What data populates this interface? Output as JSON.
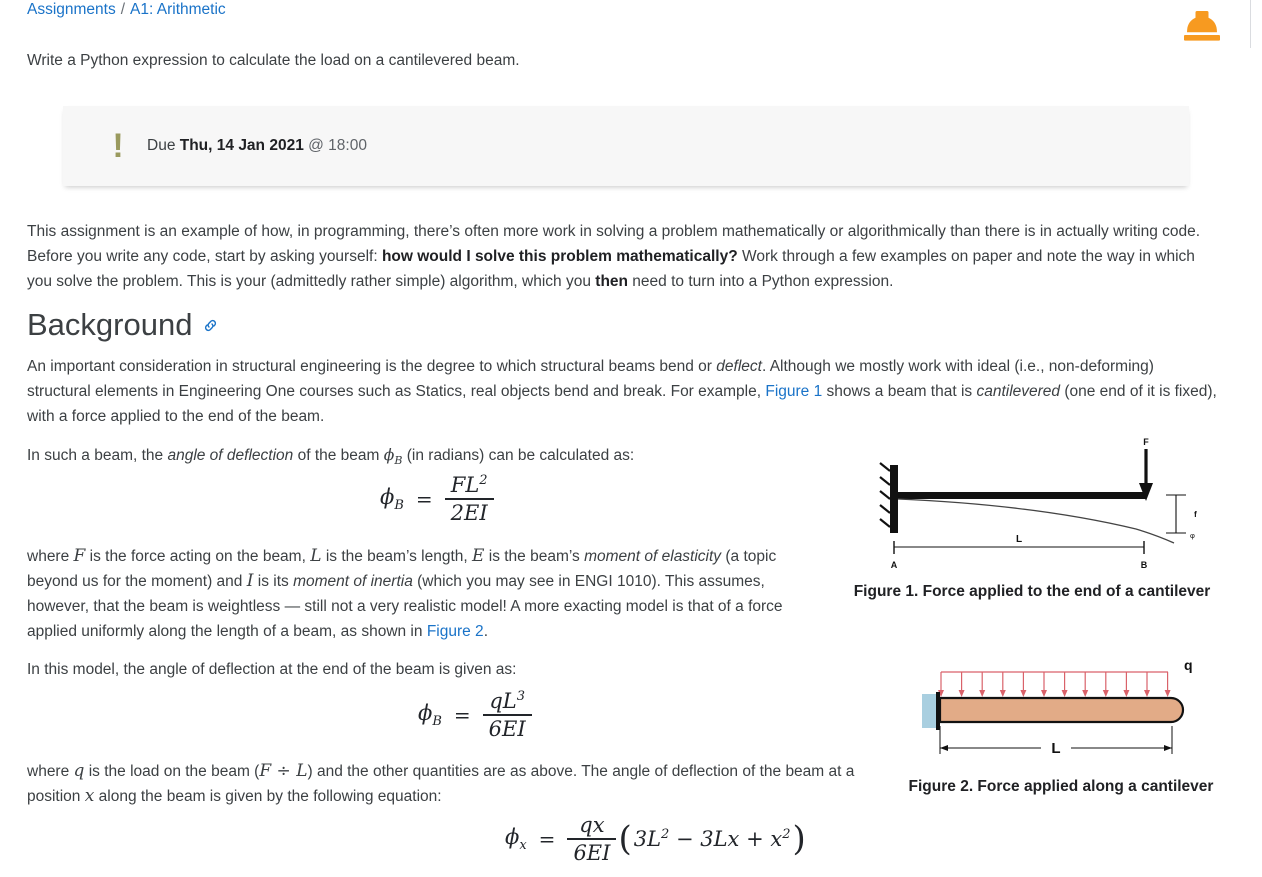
{
  "breadcrumb": {
    "items": [
      {
        "label": "Assignments"
      },
      {
        "label": "A1: Arithmetic"
      }
    ],
    "separator": "/"
  },
  "logo": {
    "icon": "hard-hat-icon",
    "color": "#f79a20"
  },
  "intro": {
    "text": "Write a Python expression to calculate the load on a cantilevered beam."
  },
  "callout": {
    "icon": "exclamation-icon",
    "icon_color": "#9a9a5e",
    "due_prefix": "Due ",
    "due_date": "Thu, 14 Jan 2021",
    "due_time": " @ 18:00",
    "background": "#f7f7f7"
  },
  "paragraphs": {
    "intro2": {
      "part1": "This assignment is an example of how, in programming, there’s often more work in solving a problem mathematically or algorithmically than there is in actually writing code. Before you write any code, start by asking yourself: ",
      "bold1": "how would I solve this problem mathematically?",
      "part2": " Work through a few examples on paper and note the way in which you solve the problem. This is your (admittedly rather simple) algorithm, which you ",
      "bold2": "then",
      "part3": " need to turn into a Python expression."
    },
    "background1": {
      "part1": "An important consideration in structural engineering is the degree to which structural beams bend or ",
      "italic1": "deflect",
      "part2": ". Although we mostly work with ideal (i.e., non-deforming) structural elements in Engineering One courses such as Statics, real objects bend and break. For example, ",
      "link1": "Figure 1",
      "part3": " shows a beam that is ",
      "italic2": "cantilevered",
      "part4": " (one end of it is fixed), with a force applied to the end of the beam."
    },
    "in_such_a_beam": {
      "part1": "In such a beam, the ",
      "italic1": "angle of deflection",
      "part2": " of the beam ",
      "math1": "φB",
      "part3": " (in radians) can be calculated as:"
    },
    "where_f": {
      "part1": "where ",
      "math1": "F",
      "part2": " is the force acting on the beam, ",
      "math2": "L",
      "part3": " is the beam’s length, ",
      "math3": "E",
      "part4": " is the beam’s ",
      "italic1": "moment of elasticity",
      "part5": " (a topic beyond us for the moment) and ",
      "math4": "I",
      "part6": " is its ",
      "italic2": "moment of inertia",
      "part7": " (which you may see in ENGI 1010). This assumes, however, that the beam is weightless — still not a very realistic model! A more exacting model is that of a force applied uniformly along the length of a beam, as shown in ",
      "link1": "Figure 2",
      "part8": "."
    },
    "in_this_model": {
      "text": "In this model, the angle of deflection at the end of the beam is given as:"
    },
    "where_q": {
      "part1": "where ",
      "math1": "q",
      "part2": " is the load on the beam (",
      "math2": "F ÷ L",
      "part3": ") and the other quantities are as above. The angle of deflection of the beam at a position ",
      "math3": "x",
      "part4": " along the beam is given by the following equation:"
    }
  },
  "headings": {
    "background": {
      "label": "Background",
      "anchor_icon": "link-icon",
      "anchor_color": "#1a73c8"
    }
  },
  "equations": {
    "eq1": {
      "lhs": "φ",
      "lhs_sub": "B",
      "eq": "=",
      "numerator": "FL",
      "numerator_sup": "2",
      "denominator": "2EI"
    },
    "eq2": {
      "lhs": "φ",
      "lhs_sub": "B",
      "eq": "=",
      "numerator": "qL",
      "numerator_sup": "3",
      "denominator": "6EI"
    },
    "eq3": {
      "lhs": "φ",
      "lhs_sub": "x",
      "eq": "=",
      "numerator": "qx",
      "denominator": "6EI",
      "open_paren": "(",
      "t1": "3L",
      "t1_sup": "2",
      "op1": " − ",
      "t2": "3Lx",
      "op2": " + ",
      "t3": "x",
      "t3_sup": "2",
      "close_paren": ")"
    }
  },
  "figures": {
    "figure1": {
      "caption": "Figure 1. Force applied to the end of a cantilever",
      "labels": {
        "force": "F",
        "deflection": "f",
        "angle": "φ",
        "length": "L",
        "point_a": "A",
        "point_b": "B"
      }
    },
    "figure2": {
      "caption": "Figure 2. Force applied along a cantilever",
      "labels": {
        "load": "q",
        "length": "L"
      },
      "colors": {
        "beam_fill": "#e0a882",
        "support_fill": "#a9cfe0",
        "arrow": "#e0565c"
      }
    }
  }
}
